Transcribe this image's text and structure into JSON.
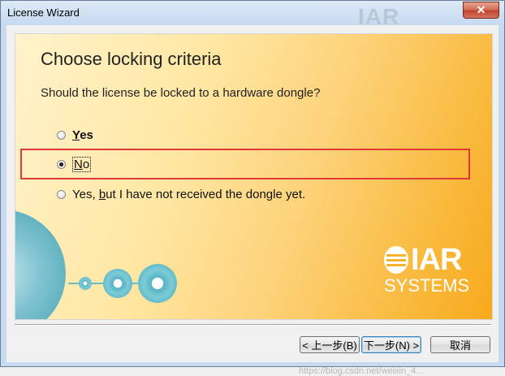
{
  "window": {
    "title": "License Wizard",
    "close_glyph": "✕",
    "title_logo_ghost": "IAR"
  },
  "panel": {
    "heading": "Choose locking criteria",
    "question": "Should the license be locked to a hardware dongle?",
    "options": [
      {
        "prefix": "",
        "underline": "Y",
        "suffix": "es",
        "checked": false
      },
      {
        "prefix": "",
        "underline": "N",
        "suffix": "o",
        "checked": true
      },
      {
        "prefix": "Yes, ",
        "underline": "b",
        "suffix": "ut I have not received the dongle yet.",
        "checked": false
      }
    ]
  },
  "logo": {
    "brand": "IAR",
    "subtitle": "SYSTEMS"
  },
  "buttons": {
    "back": "< 上一步(B)",
    "next": "下一步(N) >",
    "cancel": "取消"
  },
  "watermark": "https://blog.csdn.net/weixin_4..."
}
